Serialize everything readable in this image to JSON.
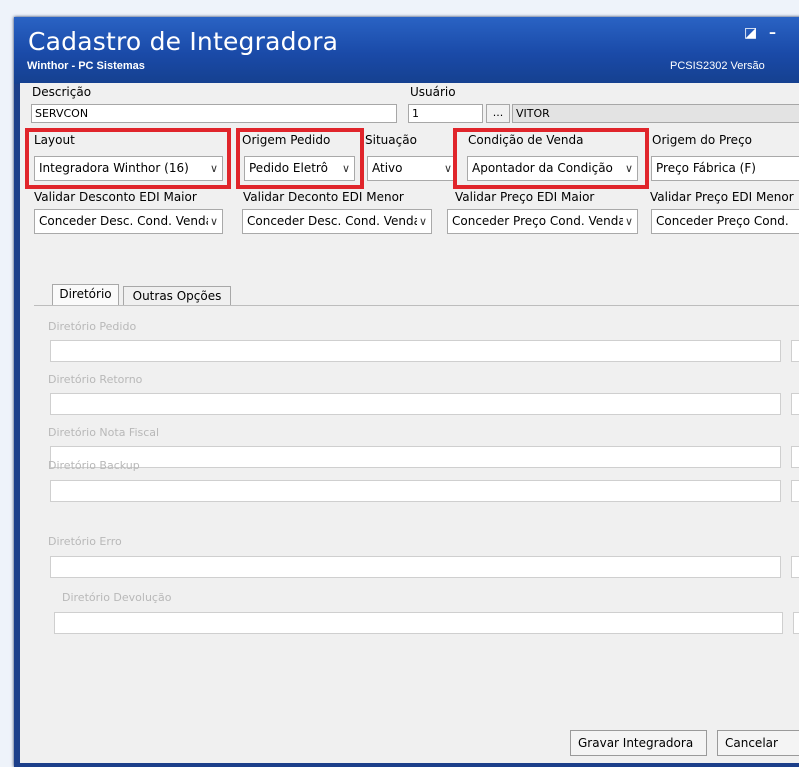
{
  "window": {
    "title": "Cadastro de Integradora",
    "subtitle": "Winthor - PC Sistemas",
    "version": "PCSIS2302  Versão",
    "restore_glyph": "◪",
    "minimize_glyph": "–"
  },
  "fields": {
    "descricao_label": "Descrição",
    "descricao_value": "SERVCON",
    "usuario_label": "Usuário",
    "usuario_code": "1",
    "usuario_lookup": "...",
    "usuario_name": "VITOR",
    "layout_label": "Layout",
    "layout_value": "Integradora Winthor (16)",
    "origem_pedido_label": "Origem Pedido",
    "origem_pedido_value": "Pedido Eletrô",
    "situacao_label": "Situação",
    "situacao_value": "Ativo",
    "condicao_venda_label": "Condição de Venda",
    "condicao_venda_value": "Apontador da Condição",
    "origem_preco_label": "Origem do Preço",
    "origem_preco_value": "Preço Fábrica (F)",
    "validar_desc_maior_label": "Validar Desconto EDI Maior",
    "validar_desc_maior_value": "Conceder Desc. Cond. Venda",
    "validar_desc_menor_label": "Validar Deconto EDI Menor",
    "validar_desc_menor_value": "Conceder Desc. Cond. Venda",
    "validar_preco_maior_label": "Validar Preço EDI Maior",
    "validar_preco_maior_value": "Conceder Preço Cond. Venda",
    "validar_preco_menor_label": "Validar Preço EDI Menor",
    "validar_preco_menor_value": "Conceder Preço Cond."
  },
  "tabs": {
    "diretorio": "Diretório",
    "outras_opcoes": "Outras Opções"
  },
  "directories": {
    "pedido": "Diretório Pedido",
    "retorno": "Diretório Retorno",
    "nota_fiscal": "Diretório Nota Fiscal",
    "backup": "Diretório Backup",
    "erro": "Diretório Erro",
    "devolucao": "Diretório Devolução"
  },
  "buttons": {
    "gravar": "Gravar Integradora",
    "cancelar": "Cancelar"
  },
  "icons": {
    "dropdown": "chevron-down-icon"
  },
  "colors": {
    "highlight": "#e0252b",
    "titlebar": "#1a4aa8"
  }
}
